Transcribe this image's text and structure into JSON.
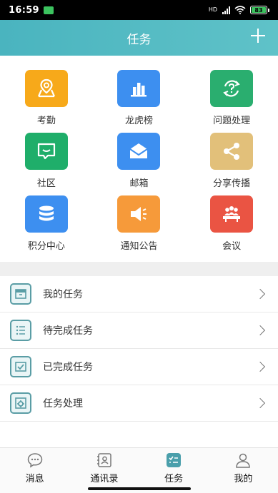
{
  "status": {
    "time": "16:59",
    "network": "HD",
    "battery": "83"
  },
  "header": {
    "title": "任务"
  },
  "grid": [
    {
      "label": "考勤",
      "icon": "map-pin-icon",
      "color": "#f7a91a"
    },
    {
      "label": "龙虎榜",
      "icon": "bar-chart-icon",
      "color": "#3d8ff0"
    },
    {
      "label": "问题处理",
      "icon": "question-refresh-icon",
      "color": "#2aae6f"
    },
    {
      "label": "社区",
      "icon": "chat-icon",
      "color": "#1fae6a"
    },
    {
      "label": "邮箱",
      "icon": "mail-icon",
      "color": "#3d8ff0"
    },
    {
      "label": "分享传播",
      "icon": "share-icon",
      "color": "#e2c07a"
    },
    {
      "label": "积分中心",
      "icon": "database-icon",
      "color": "#3d8ff0"
    },
    {
      "label": "通知公告",
      "icon": "megaphone-icon",
      "color": "#f69a3a"
    },
    {
      "label": "会议",
      "icon": "meeting-icon",
      "color": "#ea5443"
    }
  ],
  "list": [
    {
      "label": "我的任务",
      "icon": "inbox-icon"
    },
    {
      "label": "待完成任务",
      "icon": "list-icon"
    },
    {
      "label": "已完成任务",
      "icon": "check-icon"
    },
    {
      "label": "任务处理",
      "icon": "settings-icon"
    }
  ],
  "tabs": [
    {
      "label": "消息",
      "icon": "chat-bubble-icon"
    },
    {
      "label": "通讯录",
      "icon": "contacts-icon"
    },
    {
      "label": "任务",
      "icon": "task-icon"
    },
    {
      "label": "我的",
      "icon": "user-icon"
    }
  ],
  "colors": {
    "accent": "#4ab4bf",
    "list_icon": "#5a9da5"
  }
}
